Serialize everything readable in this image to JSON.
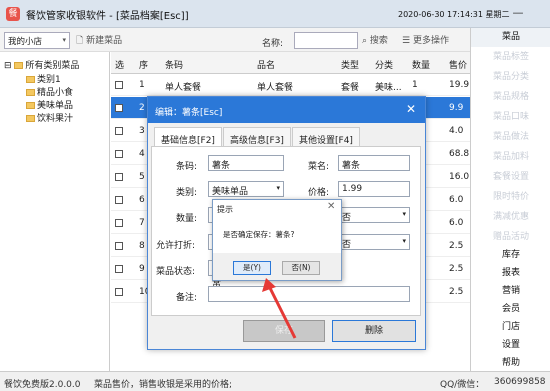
{
  "titlebar": {
    "title": "餐饮管家收银软件 - [菜品档案[Esc]]",
    "datetime": "2020-06-30 17:14:31 星期二",
    "minimize": "—"
  },
  "toolbar": {
    "shop": "我的小店",
    "new_item": "新建菜品",
    "name_label": "名称:",
    "search": "搜索",
    "more_ops": "更多操作"
  },
  "tree": {
    "root": "所有类别菜品",
    "children": [
      "类别1",
      "精品小食",
      "美味单品",
      "饮料果汁"
    ]
  },
  "grid": {
    "headers": [
      "选",
      "序",
      "条码",
      "品名",
      "类型",
      "分类",
      "数量",
      "售价"
    ],
    "rows": [
      {
        "seq": "1",
        "code": "单人套餐",
        "name": "单人套餐",
        "type": "套餐",
        "cat": "美味...",
        "qty": "1",
        "price": "19.9"
      },
      {
        "seq": "2",
        "code": "",
        "name": "",
        "type": "",
        "cat": "",
        "qty": "",
        "price": "9.9"
      },
      {
        "seq": "3",
        "code": "",
        "name": "",
        "type": "",
        "cat": "",
        "qty": "",
        "price": "4.0"
      },
      {
        "seq": "4",
        "code": "",
        "name": "",
        "type": "",
        "cat": "",
        "qty": "",
        "price": "68.8"
      },
      {
        "seq": "5",
        "code": "",
        "name": "",
        "type": "",
        "cat": "",
        "qty": "",
        "price": "16.0"
      },
      {
        "seq": "6",
        "code": "",
        "name": "",
        "type": "",
        "cat": "",
        "qty": "",
        "price": "6.0"
      },
      {
        "seq": "7",
        "code": "",
        "name": "",
        "type": "",
        "cat": "",
        "qty": "",
        "price": "6.0"
      },
      {
        "seq": "8",
        "code": "",
        "name": "",
        "type": "",
        "cat": "",
        "qty": "",
        "price": "2.5"
      },
      {
        "seq": "9",
        "code": "",
        "name": "",
        "type": "",
        "cat": "",
        "qty": "",
        "price": "2.5"
      },
      {
        "seq": "10",
        "code": "",
        "name": "",
        "type": "",
        "cat": "",
        "qty": "",
        "price": "2.5"
      }
    ]
  },
  "sidebar": {
    "items": [
      "菜品",
      "菜品标签",
      "菜品分类",
      "菜品规格",
      "菜品口味",
      "菜品做法",
      "菜品加料",
      "套餐设置",
      "限时特价",
      "满减优惠",
      "赠品活动"
    ],
    "lower": [
      "库存",
      "报表",
      "营销",
      "会员",
      "门店",
      "设置",
      "帮助"
    ]
  },
  "edit": {
    "title": "编辑：薯条[Esc]",
    "close": "✕",
    "tabs": [
      "基础信息[F2]",
      "高级信息[F3]",
      "其他设置[F4]"
    ],
    "barcode_label": "条码:",
    "barcode": "薯条",
    "name_label": "菜名:",
    "name": "薯条",
    "category_label": "类别:",
    "category": "美味单品",
    "price_label": "价格:",
    "price": "1.99",
    "qty_label": "数量:",
    "qty": "1",
    "disc_label": "允许打折:",
    "disc": "是",
    "state_label": "菜品状态:",
    "state": "正常",
    "remark_label": "备注:",
    "remark": "",
    "r1": "否",
    "r2": "否",
    "save": "保存",
    "delete": "删除"
  },
  "prompt": {
    "title": "提示",
    "close": "✕",
    "message": "是否确定保存：薯条?",
    "yes": "是(Y)",
    "no": "否(N)"
  },
  "status": {
    "version": "餐饮免费版2.0.0.0",
    "hint": "菜品售价，销售收银是采用的价格;",
    "contact": "QQ/微信：",
    "number": "360699858"
  },
  "colors": {
    "accent": "#2b78d8",
    "arrow": "#e53935"
  }
}
